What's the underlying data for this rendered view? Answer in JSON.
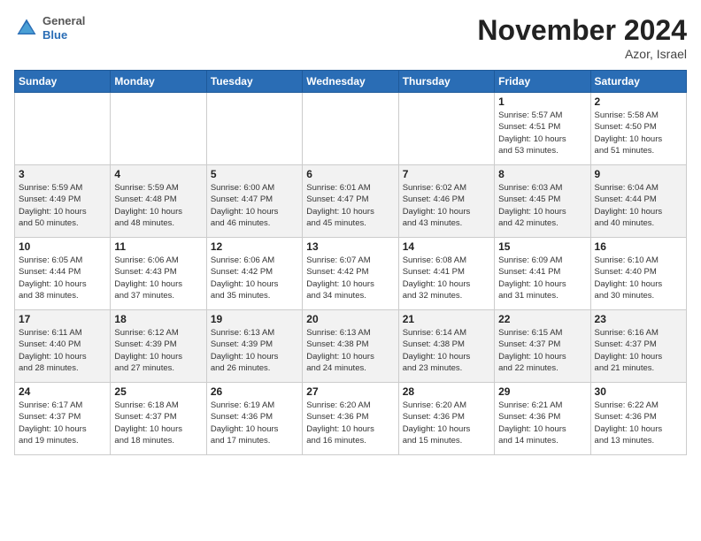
{
  "header": {
    "logo_general": "General",
    "logo_blue": "Blue",
    "month_title": "November 2024",
    "location": "Azor, Israel"
  },
  "days_of_week": [
    "Sunday",
    "Monday",
    "Tuesday",
    "Wednesday",
    "Thursday",
    "Friday",
    "Saturday"
  ],
  "weeks": [
    [
      {
        "day": "",
        "info": ""
      },
      {
        "day": "",
        "info": ""
      },
      {
        "day": "",
        "info": ""
      },
      {
        "day": "",
        "info": ""
      },
      {
        "day": "",
        "info": ""
      },
      {
        "day": "1",
        "info": "Sunrise: 5:57 AM\nSunset: 4:51 PM\nDaylight: 10 hours\nand 53 minutes."
      },
      {
        "day": "2",
        "info": "Sunrise: 5:58 AM\nSunset: 4:50 PM\nDaylight: 10 hours\nand 51 minutes."
      }
    ],
    [
      {
        "day": "3",
        "info": "Sunrise: 5:59 AM\nSunset: 4:49 PM\nDaylight: 10 hours\nand 50 minutes."
      },
      {
        "day": "4",
        "info": "Sunrise: 5:59 AM\nSunset: 4:48 PM\nDaylight: 10 hours\nand 48 minutes."
      },
      {
        "day": "5",
        "info": "Sunrise: 6:00 AM\nSunset: 4:47 PM\nDaylight: 10 hours\nand 46 minutes."
      },
      {
        "day": "6",
        "info": "Sunrise: 6:01 AM\nSunset: 4:47 PM\nDaylight: 10 hours\nand 45 minutes."
      },
      {
        "day": "7",
        "info": "Sunrise: 6:02 AM\nSunset: 4:46 PM\nDaylight: 10 hours\nand 43 minutes."
      },
      {
        "day": "8",
        "info": "Sunrise: 6:03 AM\nSunset: 4:45 PM\nDaylight: 10 hours\nand 42 minutes."
      },
      {
        "day": "9",
        "info": "Sunrise: 6:04 AM\nSunset: 4:44 PM\nDaylight: 10 hours\nand 40 minutes."
      }
    ],
    [
      {
        "day": "10",
        "info": "Sunrise: 6:05 AM\nSunset: 4:44 PM\nDaylight: 10 hours\nand 38 minutes."
      },
      {
        "day": "11",
        "info": "Sunrise: 6:06 AM\nSunset: 4:43 PM\nDaylight: 10 hours\nand 37 minutes."
      },
      {
        "day": "12",
        "info": "Sunrise: 6:06 AM\nSunset: 4:42 PM\nDaylight: 10 hours\nand 35 minutes."
      },
      {
        "day": "13",
        "info": "Sunrise: 6:07 AM\nSunset: 4:42 PM\nDaylight: 10 hours\nand 34 minutes."
      },
      {
        "day": "14",
        "info": "Sunrise: 6:08 AM\nSunset: 4:41 PM\nDaylight: 10 hours\nand 32 minutes."
      },
      {
        "day": "15",
        "info": "Sunrise: 6:09 AM\nSunset: 4:41 PM\nDaylight: 10 hours\nand 31 minutes."
      },
      {
        "day": "16",
        "info": "Sunrise: 6:10 AM\nSunset: 4:40 PM\nDaylight: 10 hours\nand 30 minutes."
      }
    ],
    [
      {
        "day": "17",
        "info": "Sunrise: 6:11 AM\nSunset: 4:40 PM\nDaylight: 10 hours\nand 28 minutes."
      },
      {
        "day": "18",
        "info": "Sunrise: 6:12 AM\nSunset: 4:39 PM\nDaylight: 10 hours\nand 27 minutes."
      },
      {
        "day": "19",
        "info": "Sunrise: 6:13 AM\nSunset: 4:39 PM\nDaylight: 10 hours\nand 26 minutes."
      },
      {
        "day": "20",
        "info": "Sunrise: 6:13 AM\nSunset: 4:38 PM\nDaylight: 10 hours\nand 24 minutes."
      },
      {
        "day": "21",
        "info": "Sunrise: 6:14 AM\nSunset: 4:38 PM\nDaylight: 10 hours\nand 23 minutes."
      },
      {
        "day": "22",
        "info": "Sunrise: 6:15 AM\nSunset: 4:37 PM\nDaylight: 10 hours\nand 22 minutes."
      },
      {
        "day": "23",
        "info": "Sunrise: 6:16 AM\nSunset: 4:37 PM\nDaylight: 10 hours\nand 21 minutes."
      }
    ],
    [
      {
        "day": "24",
        "info": "Sunrise: 6:17 AM\nSunset: 4:37 PM\nDaylight: 10 hours\nand 19 minutes."
      },
      {
        "day": "25",
        "info": "Sunrise: 6:18 AM\nSunset: 4:37 PM\nDaylight: 10 hours\nand 18 minutes."
      },
      {
        "day": "26",
        "info": "Sunrise: 6:19 AM\nSunset: 4:36 PM\nDaylight: 10 hours\nand 17 minutes."
      },
      {
        "day": "27",
        "info": "Sunrise: 6:20 AM\nSunset: 4:36 PM\nDaylight: 10 hours\nand 16 minutes."
      },
      {
        "day": "28",
        "info": "Sunrise: 6:20 AM\nSunset: 4:36 PM\nDaylight: 10 hours\nand 15 minutes."
      },
      {
        "day": "29",
        "info": "Sunrise: 6:21 AM\nSunset: 4:36 PM\nDaylight: 10 hours\nand 14 minutes."
      },
      {
        "day": "30",
        "info": "Sunrise: 6:22 AM\nSunset: 4:36 PM\nDaylight: 10 hours\nand 13 minutes."
      }
    ]
  ]
}
